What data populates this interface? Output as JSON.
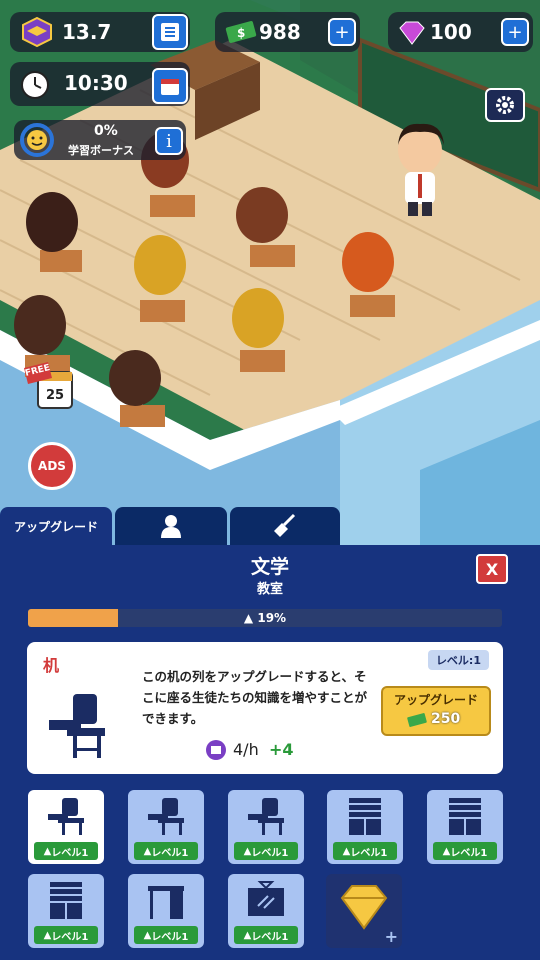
{
  "hud": {
    "xp_value": "13.7",
    "money_value": "988",
    "gems_value": "100",
    "time_value": "10:30",
    "bonus_percent": "0%",
    "bonus_label": "学習ボーナス",
    "plus_label": "+"
  },
  "badges": {
    "free_label": "FREE",
    "calendar_day": "25",
    "ads_label": "ADS"
  },
  "tabs": {
    "upgrade_label": "アップグレード"
  },
  "panel": {
    "title": "文学",
    "subtitle": "教室",
    "close_label": "X",
    "progress_text": "19%",
    "progress_value": 0.19
  },
  "item": {
    "name": "机",
    "level_badge": "レベル:1",
    "description": "この机の列をアップグレードすると、そこに座る生徒たちの知識を増やすことができます。",
    "rate": "4/h",
    "rate_bonus": "+4",
    "upgrade_label": "アップグレード",
    "upgrade_cost": "250"
  },
  "slots": [
    {
      "level_label": "レベル1",
      "icon": "desk-chair-icon"
    },
    {
      "level_label": "レベル1",
      "icon": "desk-chair-icon"
    },
    {
      "level_label": "レベル1",
      "icon": "desk-chair-icon"
    },
    {
      "level_label": "レベル1",
      "icon": "cabinet-icon"
    },
    {
      "level_label": "レベル1",
      "icon": "cabinet-icon"
    },
    {
      "level_label": "レベル1",
      "icon": "cabinet-icon"
    },
    {
      "level_label": "レベル1",
      "icon": "teacher-desk-icon"
    },
    {
      "level_label": "レベル1",
      "icon": "blackboard-icon"
    }
  ],
  "locked_slot": {
    "icon": "diamond-icon",
    "plus": "+"
  },
  "colors": {
    "panel_bg": "#17337f",
    "progress_fill": "#f0a24a",
    "level_green": "#2a9a3a",
    "upgrade_yellow": "#f6c842",
    "close_red": "#d23b3b"
  }
}
